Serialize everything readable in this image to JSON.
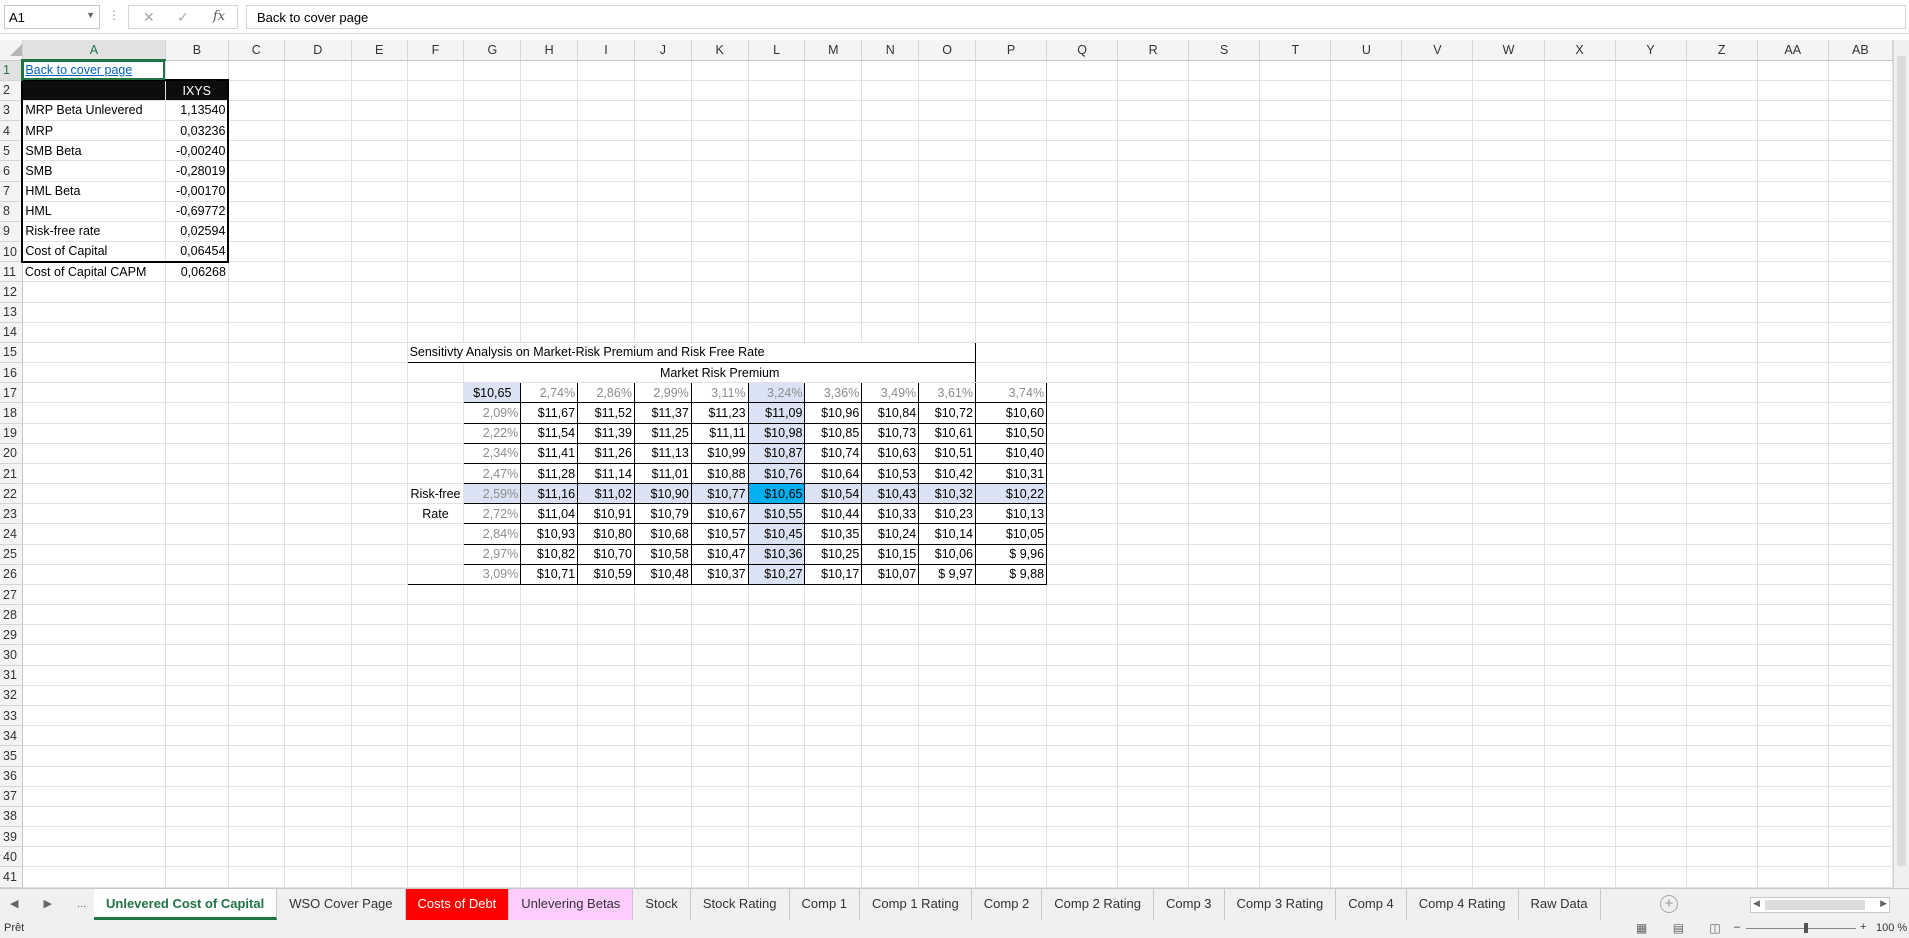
{
  "formula_bar": {
    "name_box": "A1",
    "cancel_icon": "✕",
    "enter_icon": "✓",
    "fx_label": "fx",
    "content": "Back to cover page"
  },
  "columns": [
    "A",
    "B",
    "C",
    "D",
    "E",
    "F",
    "G",
    "H",
    "I",
    "J",
    "K",
    "L",
    "M",
    "N",
    "O",
    "P",
    "Q",
    "R",
    "S",
    "T",
    "U",
    "V",
    "W",
    "X",
    "Y",
    "Z",
    "AA",
    "AB"
  ],
  "rows": [
    1,
    2,
    3,
    4,
    5,
    6,
    7,
    8,
    9,
    10,
    11,
    12,
    13,
    14,
    15,
    16,
    17,
    18,
    19,
    20,
    21,
    22,
    23,
    24,
    25,
    26,
    27,
    28,
    29,
    30,
    31,
    32,
    33,
    34,
    35,
    36,
    37,
    38,
    39,
    40,
    41
  ],
  "cover_link": "Back to cover page",
  "cost_table": {
    "header": "IXYS",
    "items": [
      {
        "label": "MRP Beta Unlevered",
        "value": "1,13540"
      },
      {
        "label": "MRP",
        "value": "0,03236"
      },
      {
        "label": "SMB Beta",
        "value": "-0,00240"
      },
      {
        "label": "SMB",
        "value": "-0,28019"
      },
      {
        "label": "HML Beta",
        "value": "-0,00170"
      },
      {
        "label": "HML",
        "value": "-0,69772"
      },
      {
        "label": "Risk-free rate",
        "value": "0,02594"
      },
      {
        "label": "Cost of Capital",
        "value": "0,06454"
      },
      {
        "label": "Cost of Capital CAPM",
        "value": "0,06268"
      }
    ]
  },
  "sensitivity": {
    "title": "Sensitivty Analysis on Market-Risk Premium and Risk Free Rate",
    "col_axis_label": "Market Risk Premium",
    "row_axis_label_1": "Risk-free",
    "row_axis_label_2": "Rate",
    "corner": "$10,65",
    "mrp": [
      "2,74%",
      "2,86%",
      "2,99%",
      "3,11%",
      "3,24%",
      "3,36%",
      "3,49%",
      "3,61%",
      "3,74%"
    ],
    "rf": [
      "2,09%",
      "2,22%",
      "2,34%",
      "2,47%",
      "2,59%",
      "2,72%",
      "2,84%",
      "2,97%",
      "3,09%"
    ],
    "values": [
      [
        "$11,67",
        "$11,52",
        "$11,37",
        "$11,23",
        "$11,09",
        "$10,96",
        "$10,84",
        "$10,72",
        "$10,60"
      ],
      [
        "$11,54",
        "$11,39",
        "$11,25",
        "$11,11",
        "$10,98",
        "$10,85",
        "$10,73",
        "$10,61",
        "$10,50"
      ],
      [
        "$11,41",
        "$11,26",
        "$11,13",
        "$10,99",
        "$10,87",
        "$10,74",
        "$10,63",
        "$10,51",
        "$10,40"
      ],
      [
        "$11,28",
        "$11,14",
        "$11,01",
        "$10,88",
        "$10,76",
        "$10,64",
        "$10,53",
        "$10,42",
        "$10,31"
      ],
      [
        "$11,16",
        "$11,02",
        "$10,90",
        "$10,77",
        "$10,65",
        "$10,54",
        "$10,43",
        "$10,32",
        "$10,22"
      ],
      [
        "$11,04",
        "$10,91",
        "$10,79",
        "$10,67",
        "$10,55",
        "$10,44",
        "$10,33",
        "$10,23",
        "$10,13"
      ],
      [
        "$10,93",
        "$10,80",
        "$10,68",
        "$10,57",
        "$10,45",
        "$10,35",
        "$10,24",
        "$10,14",
        "$10,05"
      ],
      [
        "$10,82",
        "$10,70",
        "$10,58",
        "$10,47",
        "$10,36",
        "$10,25",
        "$10,15",
        "$10,06",
        "$  9,96"
      ],
      [
        "$10,71",
        "$10,59",
        "$10,48",
        "$10,37",
        "$10,27",
        "$10,17",
        "$10,07",
        "$  9,97",
        "$  9,88"
      ]
    ]
  },
  "sheet_tabs": [
    {
      "label": "Unlevered Cost of Capital",
      "style": "active"
    },
    {
      "label": "WSO Cover Page",
      "style": ""
    },
    {
      "label": "Costs of Debt",
      "style": "red"
    },
    {
      "label": "Unlevering Betas",
      "style": "pink"
    },
    {
      "label": "Stock",
      "style": ""
    },
    {
      "label": "Stock Rating",
      "style": ""
    },
    {
      "label": "Comp 1",
      "style": ""
    },
    {
      "label": "Comp 1 Rating",
      "style": ""
    },
    {
      "label": "Comp 2",
      "style": ""
    },
    {
      "label": "Comp 2 Rating",
      "style": ""
    },
    {
      "label": "Comp 3",
      "style": ""
    },
    {
      "label": "Comp 3 Rating",
      "style": ""
    },
    {
      "label": "Comp 4",
      "style": ""
    },
    {
      "label": "Comp 4 Rating",
      "style": ""
    },
    {
      "label": "Raw Data",
      "style": ""
    }
  ],
  "tab_nav": {
    "prev": "◀",
    "next": "▶",
    "more": "..."
  },
  "status": {
    "text": "Prêt",
    "zoom": "100 %",
    "zoom_minus": "–",
    "zoom_plus": "+"
  }
}
